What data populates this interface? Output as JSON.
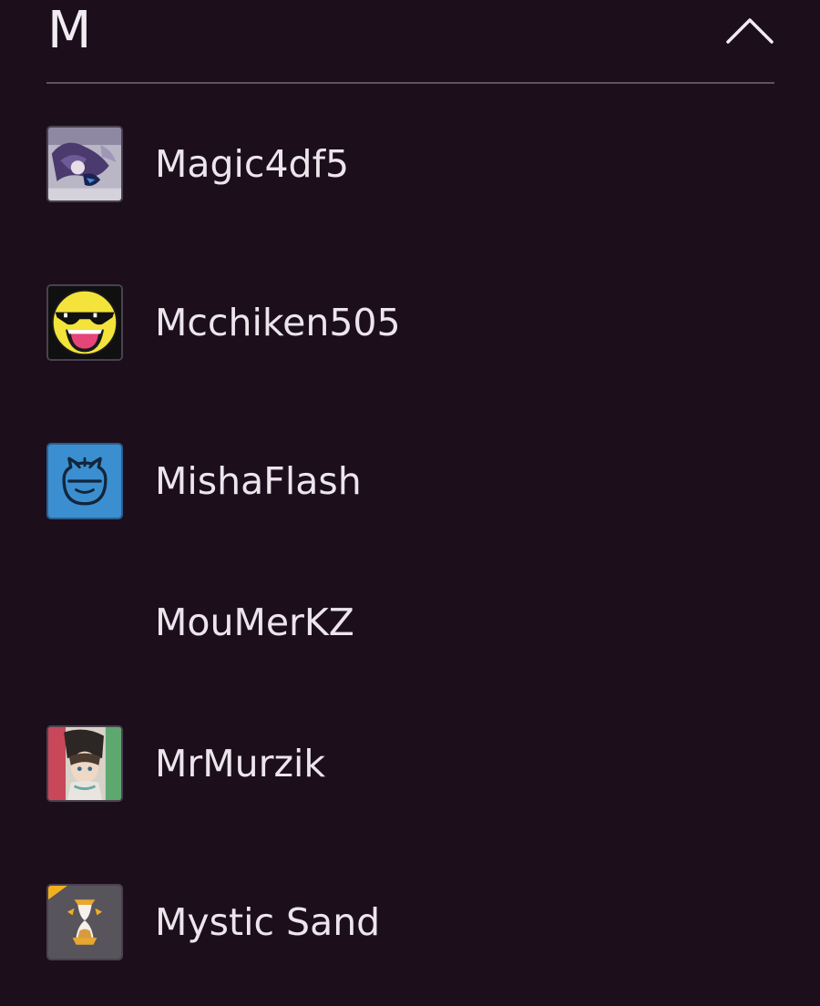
{
  "section": {
    "letter": "M",
    "toggle_icon": "chevron-up-icon"
  },
  "colors": {
    "background": "#1c0f1b",
    "divider": "#5c5260",
    "text": "#ece6ec"
  },
  "members": [
    {
      "name": "Magic4df5",
      "avatar": "anime-character-avatar"
    },
    {
      "name": "Mcchiken505",
      "avatar": "sunglasses-smiley-avatar"
    },
    {
      "name": "MishaFlash",
      "avatar": "blue-cat-face-avatar"
    },
    {
      "name": "MouMerKZ",
      "avatar": ""
    },
    {
      "name": "MrMurzik",
      "avatar": "anime-portrait-avatar"
    },
    {
      "name": "Mystic Sand",
      "avatar": "hourglass-avatar"
    }
  ]
}
